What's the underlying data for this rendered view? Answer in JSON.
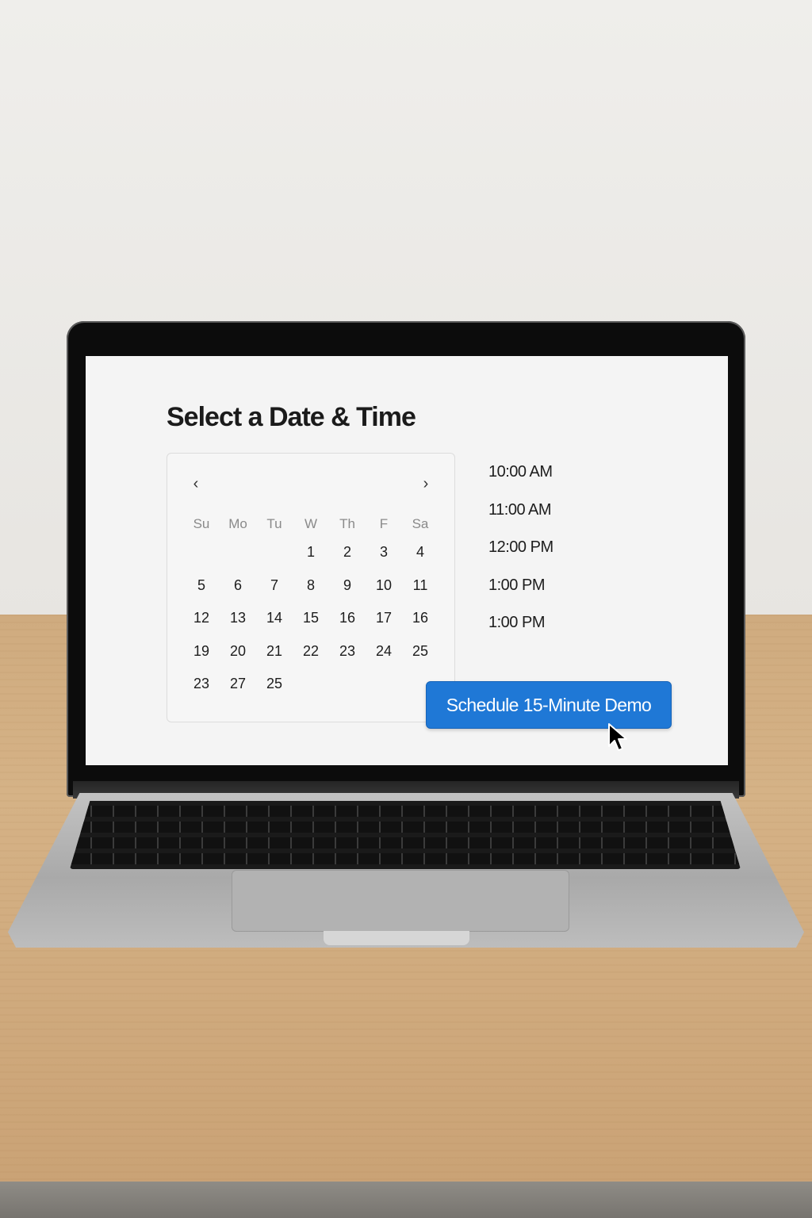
{
  "page": {
    "title": "Select a Date & Time"
  },
  "calendar": {
    "prev_icon": "chevron-left-icon",
    "next_icon": "chevron-right-icon",
    "weekdays": [
      "Su",
      "Mo",
      "Tu",
      "W",
      "Th",
      "F",
      "Sa"
    ],
    "weeks": [
      [
        "",
        "",
        "",
        "1",
        "2",
        "3",
        "4"
      ],
      [
        "5",
        "6",
        "7",
        "8",
        "9",
        "10",
        "11"
      ],
      [
        "12",
        "13",
        "14",
        "15",
        "16",
        "17",
        "16"
      ],
      [
        "19",
        "20",
        "21",
        "22",
        "23",
        "24",
        "25"
      ],
      [
        "23",
        "27",
        "25",
        "",
        "",
        "",
        ""
      ]
    ]
  },
  "times": [
    "10:00 AM",
    "11:00 AM",
    "12:00 PM",
    "1:00 PM",
    "1:00 PM"
  ],
  "cta": {
    "label": "Schedule 15-Minute Demo",
    "color": "#1f78d6"
  },
  "cursor": {
    "icon": "mouse-pointer-icon"
  }
}
